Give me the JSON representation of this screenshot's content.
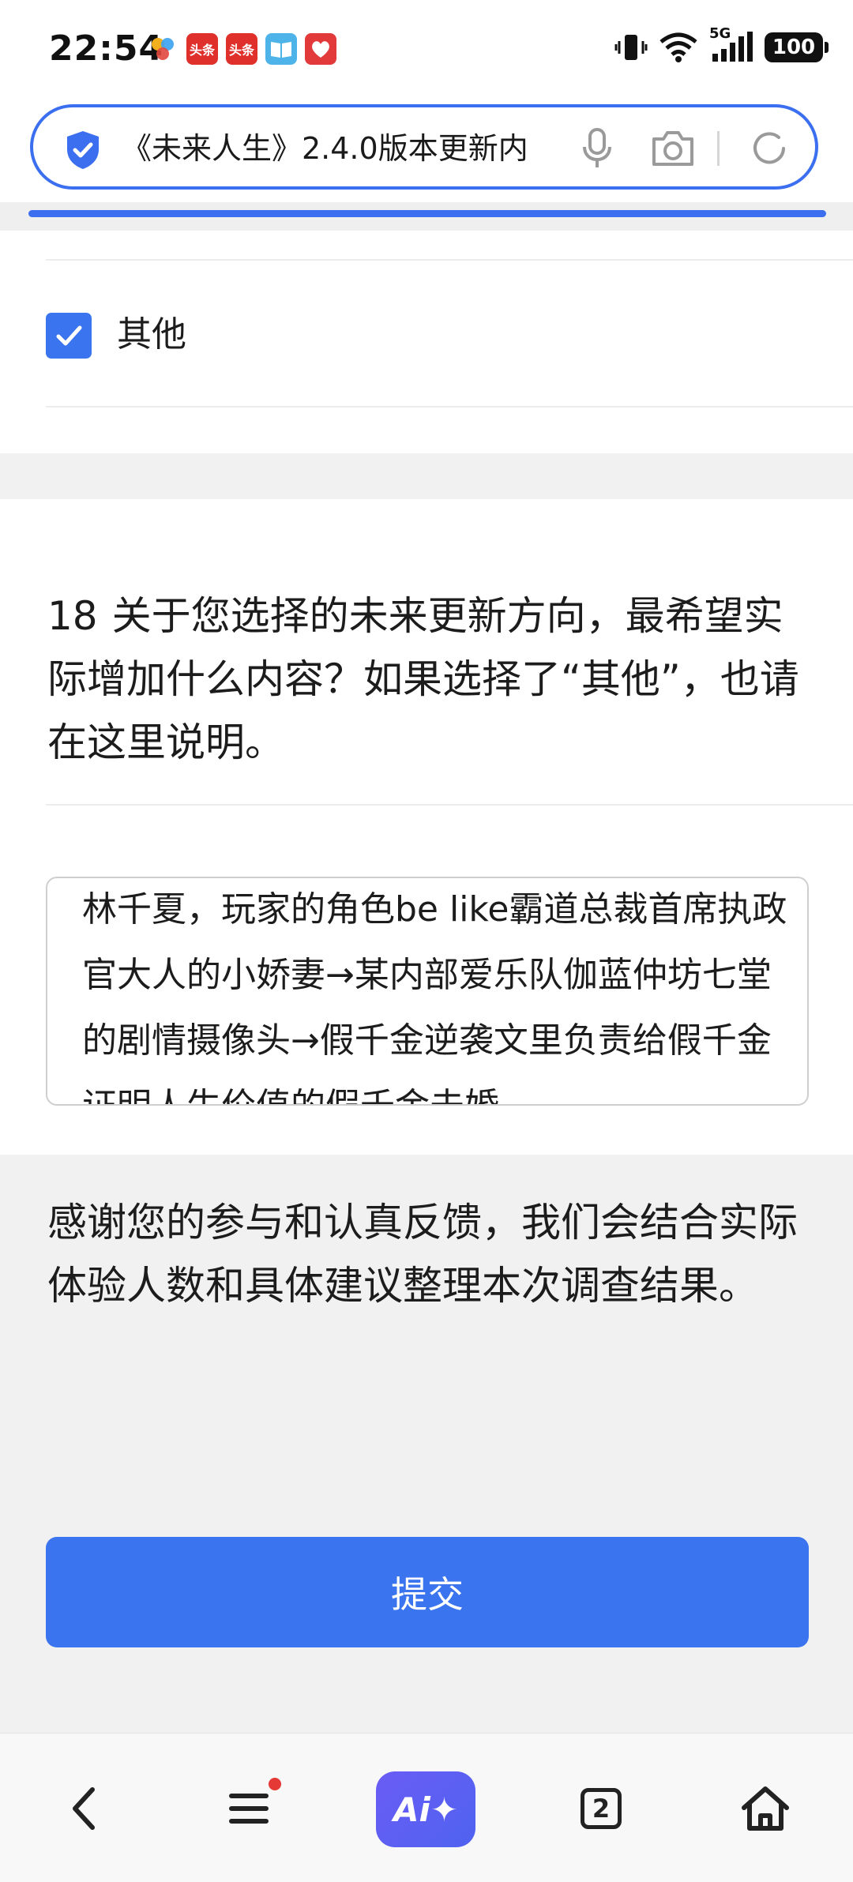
{
  "status_bar": {
    "time": "22:54",
    "app_badges": [
      "头条",
      "头条"
    ],
    "network": "5G",
    "battery": "100"
  },
  "browser": {
    "url_text": "《未来人生》2.4.0版本更新内",
    "progress": 1.0,
    "tab_count": "2",
    "ai_label": "Ai✦"
  },
  "survey": {
    "option_other_label": "其他",
    "option_other_checked": true,
    "question_number": "18",
    "question_text": "关于您选择的未来更新方向，最希望实际增加什么内容？如果选择了“其他”，也请在这里说明。",
    "answer_text": "林千夏，玩家的角色be like霸道总裁首席执政官大人的小娇妻→某内部爱乐队伽蓝仲坊七堂的剧情摄像头→假千金逆袭文里负责给假千金证明人生价值的假千金未婚",
    "thanks_text": "感谢您的参与和认真反馈，我们会结合实际体验人数和具体建议整理本次调查结果。",
    "submit_label": "提交"
  },
  "colors": {
    "accent": "#3b74ef",
    "address_border": "#3b6ff0",
    "notification_dot": "#e53935"
  }
}
